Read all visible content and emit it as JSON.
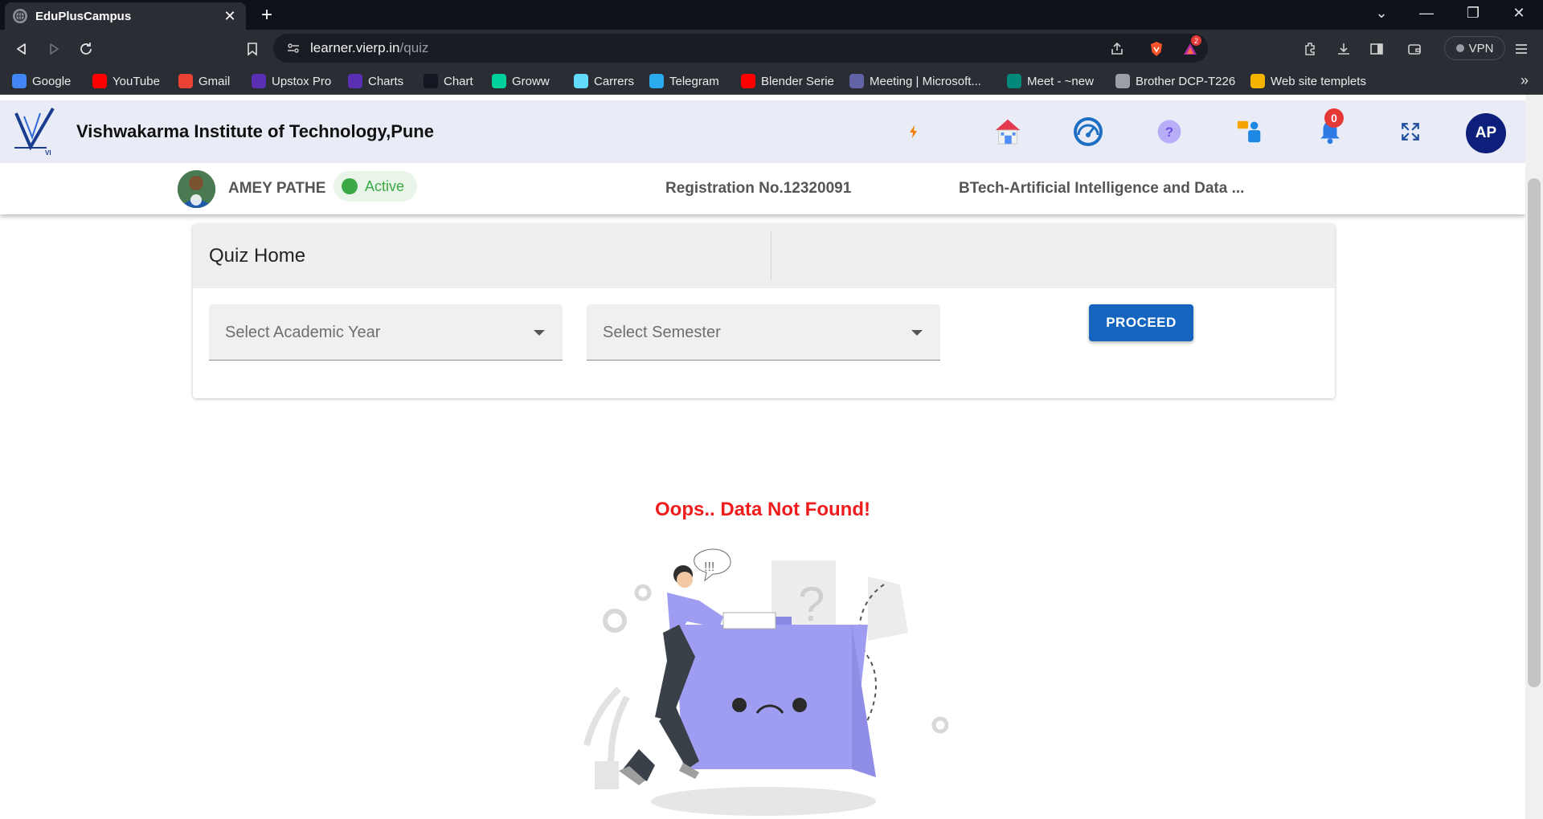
{
  "browser": {
    "tab_title": "EduPlusCampus",
    "url_host": "learner.vierp.in",
    "url_path": "/quiz",
    "vpn_label": "VPN",
    "shield_count": "2",
    "bookmarks": [
      {
        "label": "Google",
        "icon": "google-icon",
        "color": "#4285f4"
      },
      {
        "label": "YouTube",
        "icon": "youtube-icon",
        "color": "#ff0000"
      },
      {
        "label": "Gmail",
        "icon": "gmail-icon",
        "color": "#ea4335"
      },
      {
        "label": "Upstox Pro",
        "icon": "upstox-icon",
        "color": "#5a2fb3"
      },
      {
        "label": "Charts",
        "icon": "upstox-icon",
        "color": "#5a2fb3"
      },
      {
        "label": "Chart",
        "icon": "tradingview-icon",
        "color": "#131722"
      },
      {
        "label": "Groww",
        "icon": "groww-icon",
        "color": "#00d09c"
      },
      {
        "label": "Carrers",
        "icon": "react-icon",
        "color": "#61dafb"
      },
      {
        "label": "Telegram",
        "icon": "telegram-icon",
        "color": "#2aabee"
      },
      {
        "label": "Blender Serie",
        "icon": "youtube-icon",
        "color": "#ff0000"
      },
      {
        "label": "Meeting | Microsoft...",
        "icon": "teams-icon",
        "color": "#6264a7"
      },
      {
        "label": "Meet - ~new",
        "icon": "meet-icon",
        "color": "#00897b"
      },
      {
        "label": "Brother DCP-T226",
        "icon": "globe-icon",
        "color": "#9aa0a6"
      },
      {
        "label": "Web site templets",
        "icon": "templates-icon",
        "color": "#f4b400"
      }
    ]
  },
  "header": {
    "institute_name": "Vishwakarma Institute of Technology,Pune",
    "notification_count": "0",
    "avatar_initials": "AP"
  },
  "profile": {
    "name": "AMEY PATHE",
    "status": "Active",
    "registration": "Registration No.12320091",
    "program": "BTech-Artificial Intelligence and Data ..."
  },
  "quiz": {
    "title": "Quiz Home",
    "academic_year_placeholder": "Select Academic Year",
    "semester_placeholder": "Select Semester",
    "proceed_label": "PROCEED"
  },
  "empty_state": {
    "message": "Oops.. Data Not Found!"
  }
}
